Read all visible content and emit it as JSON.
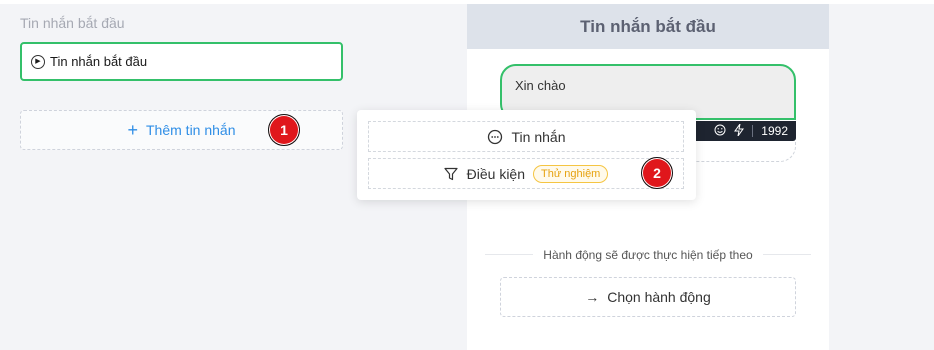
{
  "left": {
    "title": "Tin nhắn bắt đầu",
    "node_label": "Tin nhắn bắt đầu",
    "add_label": "Thêm tin nhắn",
    "step1": "1"
  },
  "popup": {
    "item1_label": "Tin nhắn",
    "item2_label": "Điều kiện",
    "item2_tag": "Thử nghiệm",
    "step2": "2"
  },
  "preview": {
    "header": "Tin nhắn bắt đầu",
    "bubble_text": "Xin chào",
    "char_count": "1992",
    "next_label": "Hành động sẽ được thực hiện tiếp theo",
    "choose_label": "Chọn hành động"
  },
  "colors": {
    "accent": "#2f8ee6",
    "success": "#34c06a",
    "danger": "#e0171c",
    "warning": "#f5c542"
  },
  "icons": [
    "play-circle-icon",
    "plus-icon",
    "chat-icon",
    "filter-icon",
    "smile-icon",
    "bolt-icon",
    "arrow-right-icon"
  ]
}
